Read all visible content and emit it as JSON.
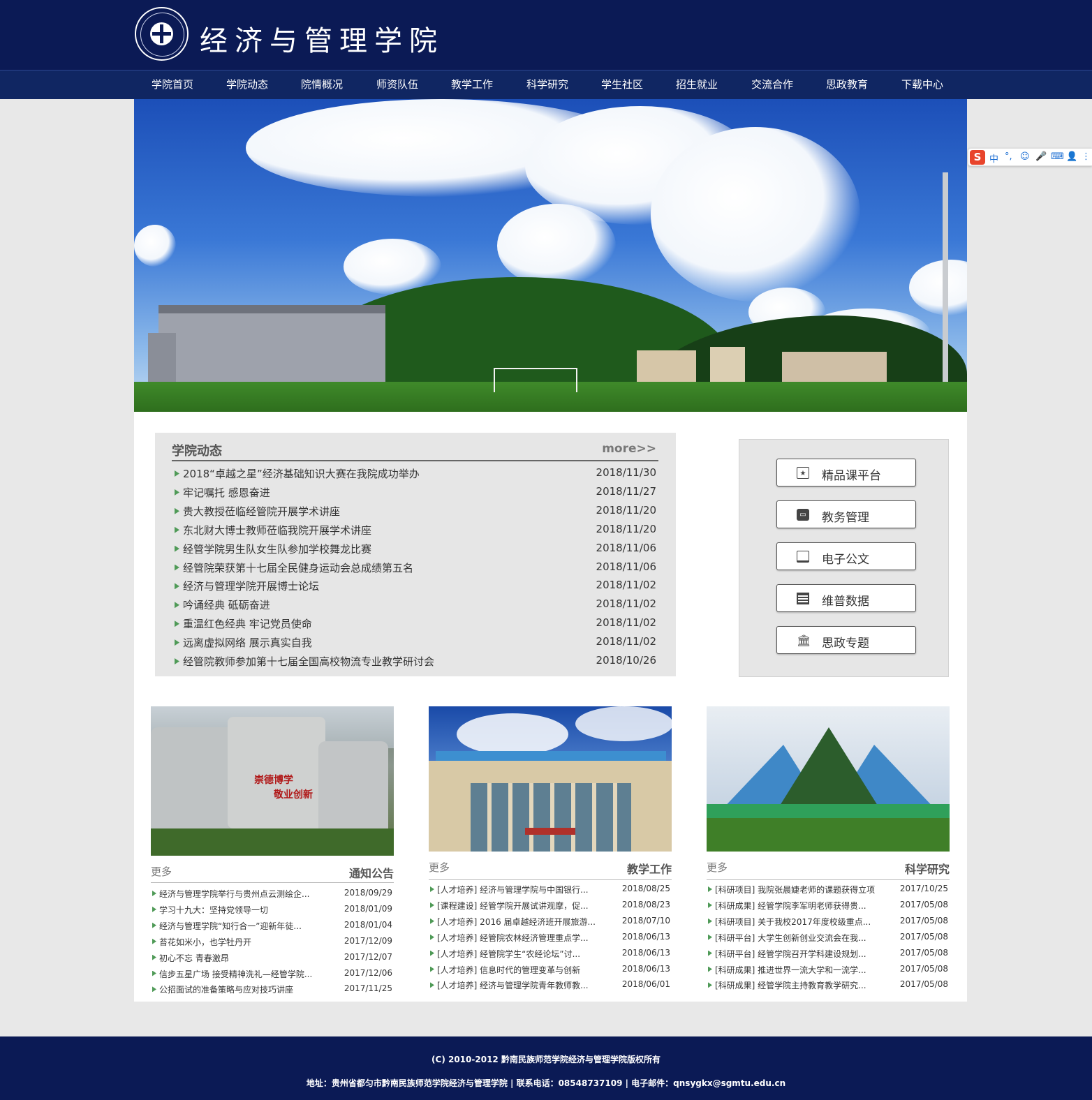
{
  "header": {
    "title": "经济与管理学院"
  },
  "nav": {
    "items": [
      "学院首页",
      "学院动态",
      "院情概况",
      "师资队伍",
      "教学工作",
      "科学研究",
      "学生社区",
      "招生就业",
      "交流合作",
      "思政教育",
      "下载中心"
    ]
  },
  "ime": {
    "logo": "S",
    "items": [
      "中",
      "°,",
      "☺",
      "🎤",
      "⌨",
      "👤",
      "⋮"
    ]
  },
  "news": {
    "title": "学院动态",
    "more": "more>>",
    "items": [
      {
        "title": "2018“卓越之星”经济基础知识大赛在我院成功举办",
        "date": "2018/11/30"
      },
      {
        "title": "牢记嘱托 感恩奋进",
        "date": "2018/11/27"
      },
      {
        "title": "贵大教授莅临经管院开展学术讲座",
        "date": "2018/11/20"
      },
      {
        "title": "东北财大博士教师莅临我院开展学术讲座",
        "date": "2018/11/20"
      },
      {
        "title": "经管学院男生队女生队参加学校舞龙比赛",
        "date": "2018/11/06"
      },
      {
        "title": "经管院荣获第十七届全民健身运动会总成绩第五名",
        "date": "2018/11/06"
      },
      {
        "title": "经济与管理学院开展博士论坛",
        "date": "2018/11/02"
      },
      {
        "title": "吟诵经典 砥砺奋进",
        "date": "2018/11/02"
      },
      {
        "title": "重温红色经典 牢记党员使命",
        "date": "2018/11/02"
      },
      {
        "title": "远离虚拟网络 展示真实自我",
        "date": "2018/11/02"
      },
      {
        "title": "经管院教师参加第十七届全国高校物流专业教学研讨会",
        "date": "2018/10/26"
      }
    ]
  },
  "quick_links": [
    {
      "label": "精品课平台",
      "icon": "star-document-icon"
    },
    {
      "label": "教务管理",
      "icon": "inbox-icon"
    },
    {
      "label": "电子公文",
      "icon": "monitor-icon"
    },
    {
      "label": "维普数据",
      "icon": "newspaper-icon"
    },
    {
      "label": "思政专题",
      "icon": "institution-icon"
    }
  ],
  "columns": [
    {
      "more": "更多",
      "heading": "通知公告",
      "image_text": [
        "崇德博学",
        "敬业创新"
      ],
      "items": [
        {
          "title": "经济与管理学院举行与贵州点云测绘企...",
          "date": "2018/09/29"
        },
        {
          "title": "学习十九大：坚持党领导一切",
          "date": "2018/01/09"
        },
        {
          "title": "经济与管理学院“知行合一”迎新年徒...",
          "date": "2018/01/04"
        },
        {
          "title": "苔花如米小，也学牡丹开",
          "date": "2017/12/09"
        },
        {
          "title": "初心不忘 青春激昂",
          "date": "2017/12/07"
        },
        {
          "title": "信步五星广场 接受精神洗礼—经管学院...",
          "date": "2017/12/06"
        },
        {
          "title": "公招面试的准备策略与应对技巧讲座",
          "date": "2017/11/25"
        }
      ]
    },
    {
      "more": "更多",
      "heading": "教学工作",
      "image_text": [],
      "items": [
        {
          "title": "[人才培养] 经济与管理学院与中国银行...",
          "date": "2018/08/25"
        },
        {
          "title": "[课程建设] 经管学院开展试讲观摩，促...",
          "date": "2018/08/23"
        },
        {
          "title": "[人才培养] 2016 届卓越经济班开展旅游...",
          "date": "2018/07/10"
        },
        {
          "title": "[人才培养] 经管院农林经济管理重点学...",
          "date": "2018/06/13"
        },
        {
          "title": "[人才培养] 经管院学生“农经论坛”讨...",
          "date": "2018/06/13"
        },
        {
          "title": "[人才培养] 信息时代的管理变革与创新",
          "date": "2018/06/13"
        },
        {
          "title": "[人才培养] 经济与管理学院青年教师教...",
          "date": "2018/06/01"
        }
      ]
    },
    {
      "more": "更多",
      "heading": "科学研究",
      "image_text": [],
      "items": [
        {
          "title": "[科研项目] 我院张晨婕老师的课题获得立项",
          "date": "2017/10/25"
        },
        {
          "title": "[科研成果] 经管学院李军明老师获得贵...",
          "date": "2017/05/08"
        },
        {
          "title": "[科研项目] 关于我校2017年度校级重点...",
          "date": "2017/05/08"
        },
        {
          "title": "[科研平台] 大学生创新创业交流会在我...",
          "date": "2017/05/08"
        },
        {
          "title": "[科研平台] 经管学院召开学科建设规划...",
          "date": "2017/05/08"
        },
        {
          "title": "[科研成果] 推进世界一流大学和一流学...",
          "date": "2017/05/08"
        },
        {
          "title": "[科研成果] 经管学院主持教育教学研究...",
          "date": "2017/05/08"
        }
      ]
    }
  ],
  "footer": {
    "copyright": "(C) 2010-2012 黔南民族师范学院经济与管理学院版权所有",
    "address": "地址：贵州省都匀市黔南民族师范学院经济与管理学院 | 联系电话：08548737109 | 电子邮件：qnsygkx@sgmtu.edu.cn"
  },
  "colors": {
    "header_bg": "#0b1a55",
    "nav_bg": "#102662",
    "panel_bg": "#e6e6e6",
    "bullet": "#4f9a57"
  }
}
